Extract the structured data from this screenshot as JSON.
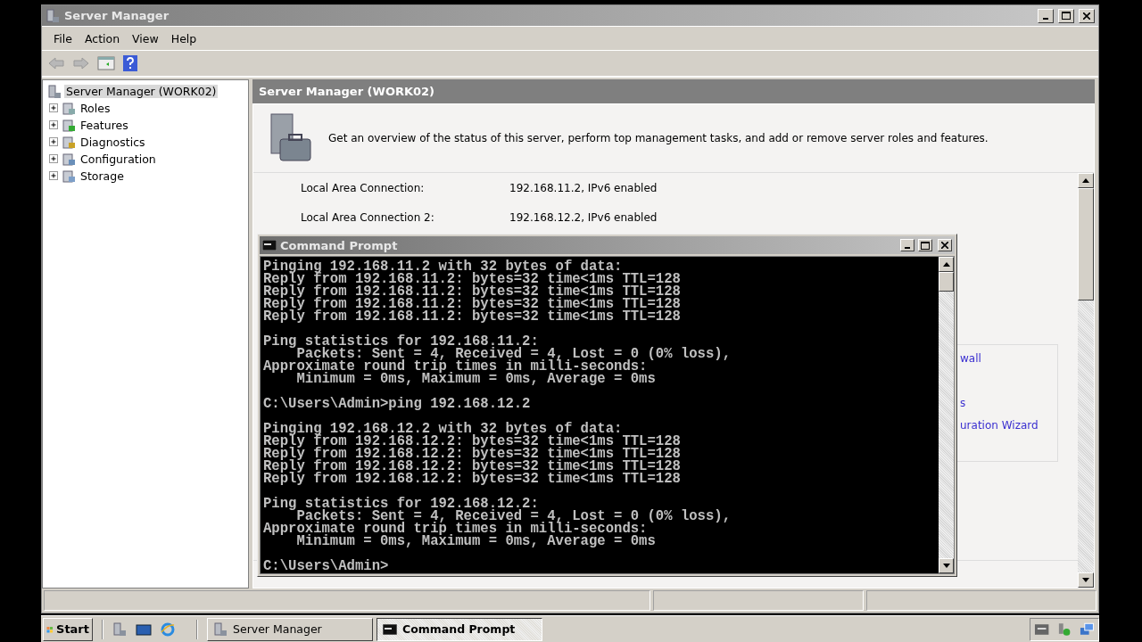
{
  "window": {
    "title": "Server Manager"
  },
  "menu": [
    "File",
    "Action",
    "View",
    "Help"
  ],
  "tree": [
    {
      "label": "Server Manager (WORK02)",
      "selected": true,
      "kind": "root"
    },
    {
      "label": "Roles",
      "selected": false,
      "expanded": false,
      "kind": "node"
    },
    {
      "label": "Features",
      "selected": false,
      "expanded": false,
      "kind": "node"
    },
    {
      "label": "Diagnostics",
      "selected": false,
      "expanded": false,
      "kind": "node"
    },
    {
      "label": "Configuration",
      "selected": false,
      "expanded": false,
      "kind": "node"
    },
    {
      "label": "Storage",
      "selected": false,
      "expanded": false,
      "kind": "node"
    }
  ],
  "details": {
    "header": "Server Manager (WORK02)",
    "description": "Get an overview of the status of this server, perform top management tasks, and add or remove server roles and features.",
    "connections": [
      {
        "name": "Local Area Connection:",
        "value": "192.168.11.2, IPv6 enabled"
      },
      {
        "name": "Local Area Connection 2:",
        "value": "192.168.12.2, IPv6 enabled"
      }
    ],
    "links": [
      "wall",
      "s",
      "uration Wizard"
    ]
  },
  "console": {
    "title": "Command Prompt",
    "blocks": [
      [
        "Pinging 192.168.11.2 with 32 bytes of data:",
        "Reply from 192.168.11.2: bytes=32 time<1ms TTL=128",
        "Reply from 192.168.11.2: bytes=32 time<1ms TTL=128",
        "Reply from 192.168.11.2: bytes=32 time<1ms TTL=128",
        "Reply from 192.168.11.2: bytes=32 time<1ms TTL=128"
      ],
      [
        "Ping statistics for 192.168.11.2:",
        "    Packets: Sent = 4, Received = 4, Lost = 0 (0% loss),",
        "Approximate round trip times in milli-seconds:",
        "    Minimum = 0ms, Maximum = 0ms, Average = 0ms"
      ],
      [
        "C:\\Users\\Admin>ping 192.168.12.2"
      ],
      [
        "Pinging 192.168.12.2 with 32 bytes of data:",
        "Reply from 192.168.12.2: bytes=32 time<1ms TTL=128",
        "Reply from 192.168.12.2: bytes=32 time<1ms TTL=128",
        "Reply from 192.168.12.2: bytes=32 time<1ms TTL=128",
        "Reply from 192.168.12.2: bytes=32 time<1ms TTL=128"
      ],
      [
        "Ping statistics for 192.168.12.2:",
        "    Packets: Sent = 4, Received = 4, Lost = 0 (0% loss),",
        "Approximate round trip times in milli-seconds:",
        "    Minimum = 0ms, Maximum = 0ms, Average = 0ms"
      ],
      [
        "C:\\Users\\Admin>"
      ]
    ]
  },
  "taskbar": {
    "start": "Start",
    "tasks": [
      {
        "label": "Server Manager",
        "selected": false,
        "kind": "server"
      },
      {
        "label": "Command Prompt",
        "selected": true,
        "kind": "console"
      }
    ]
  }
}
